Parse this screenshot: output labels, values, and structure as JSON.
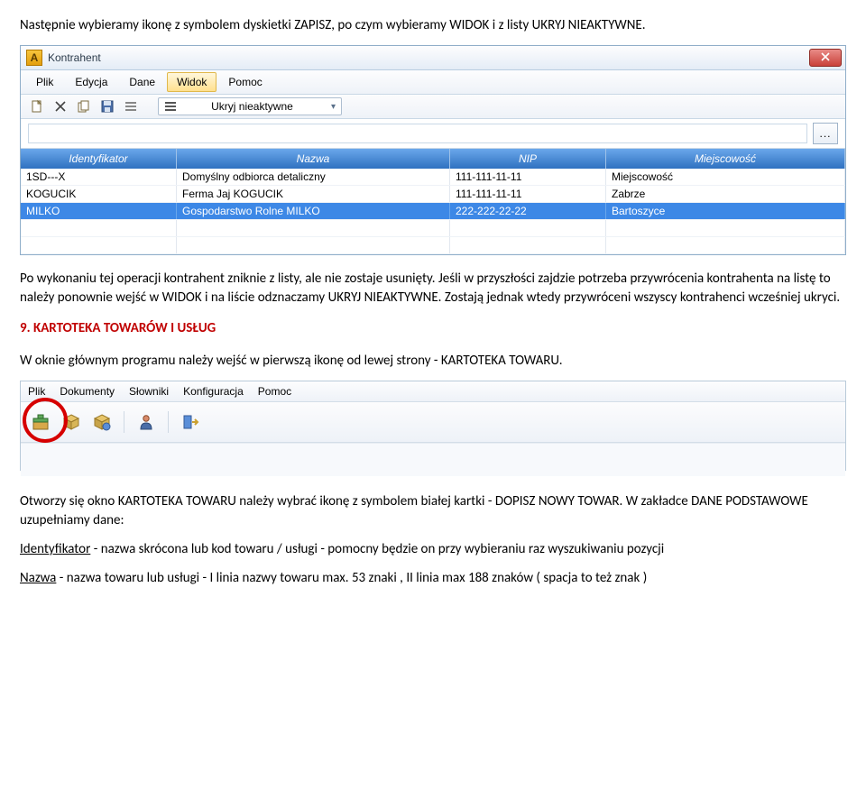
{
  "doc": {
    "intro": "Następnie wybieramy ikonę z symbolem dyskietki ZAPISZ, po czym wybieramy WIDOK i z listy UKRYJ NIEAKTYWNE.",
    "after_shot1": "Po wykonaniu tej operacji kontrahent zniknie z listy, ale nie zostaje usunięty. Jeśli w przyszłości zajdzie potrzeba przywrócenia kontrahenta na listę to należy ponownie wejść w WIDOK i na liście odznaczamy UKRYJ NIEAKTYWNE. Zostają jednak wtedy przywróceni wszyscy kontrahenci wcześniej ukryci.",
    "section9": "9. KARTOTEKA TOWARÓW I USŁUG",
    "mainprog_intro": "W oknie głównym programu należy wejść w pierwszą ikonę od lewej strony - KARTOTEKA TOWARU.",
    "after_shot2": "Otworzy się okno KARTOTEKA TOWARU należy wybrać ikonę z symbolem białej kartki - DOPISZ NOWY TOWAR. W zakładce DANE PODSTAWOWE uzupełniamy dane:",
    "ident_label": "Identyfikator",
    "ident_desc": " - nazwa skrócona lub kod towaru / usługi - pomocny będzie on przy wybieraniu raz wyszukiwaniu pozycji",
    "nazwa_label": "Nazwa",
    "nazwa_desc": " - nazwa towaru lub usługi - I linia nazwy towaru max. 53 znaki , II linia max 188 znaków ( spacja to też znak )"
  },
  "win1": {
    "icon_letter": "A",
    "title": "Kontrahent",
    "menu": [
      "Plik",
      "Edycja",
      "Dane",
      "Widok",
      "Pomoc"
    ],
    "menu_active_index": 3,
    "dropdown_value": "Ukryj nieaktywne",
    "dots": "...",
    "columns": [
      "Identyfikator",
      "Nazwa",
      "NIP",
      "Miejscowość"
    ],
    "rows": [
      {
        "id": "1SD---X",
        "nazwa": "Domyślny odbiorca detaliczny",
        "nip": "111-111-11-11",
        "miejsc": "Miejscowość",
        "selected": false
      },
      {
        "id": "KOGUCIK",
        "nazwa": "Ferma Jaj KOGUCIK",
        "nip": "111-111-11-11",
        "miejsc": "Zabrze",
        "selected": false
      },
      {
        "id": "MILKO",
        "nazwa": "Gospodarstwo Rolne MILKO",
        "nip": "222-222-22-22",
        "miejsc": "Bartoszyce",
        "selected": true
      }
    ]
  },
  "win2": {
    "menu": [
      "Plik",
      "Dokumenty",
      "Słowniki",
      "Konfiguracja",
      "Pomoc"
    ]
  }
}
